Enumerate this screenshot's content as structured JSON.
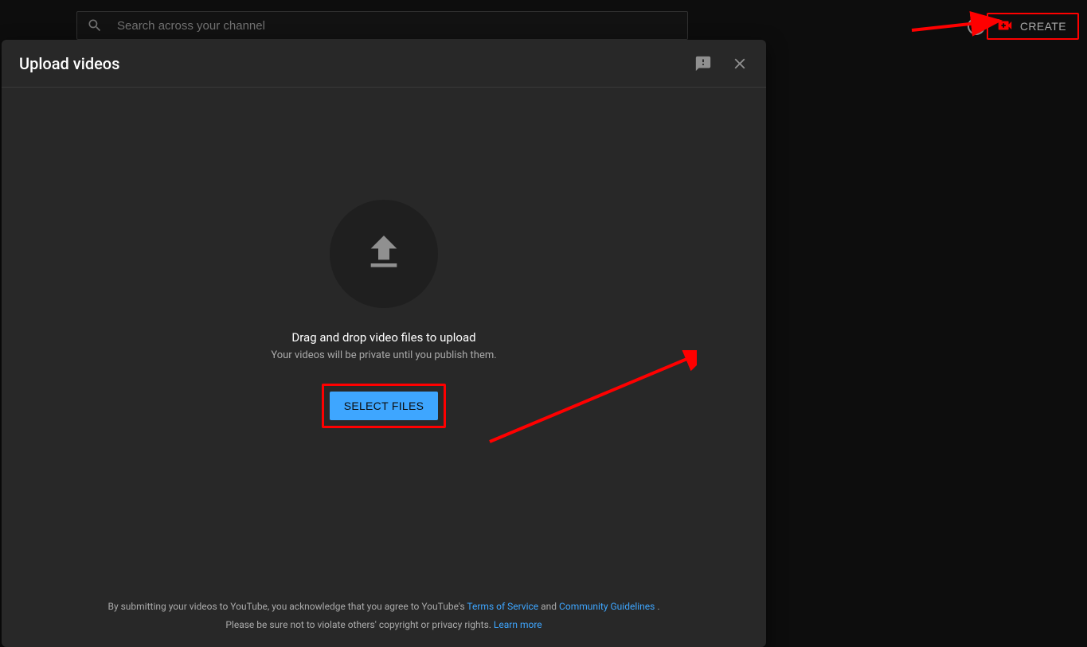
{
  "topbar": {
    "search_placeholder": "Search across your channel",
    "create_label": "CREATE"
  },
  "modal": {
    "title": "Upload videos",
    "drag_title": "Drag and drop video files to upload",
    "drag_sub": "Your videos will be private until you publish them.",
    "select_button": "SELECT FILES",
    "footer_prefix": "By submitting your videos to YouTube, you acknowledge that you agree to YouTube's ",
    "tos": "Terms of Service",
    "and": " and ",
    "community": "Community Guidelines",
    "period": ".",
    "footer_line2_prefix": "Please be sure not to violate others' copyright or privacy rights. ",
    "learn_more": "Learn more"
  },
  "icons": {
    "search": "search-icon",
    "help": "help-icon",
    "create": "create-video-icon",
    "feedback": "feedback-icon",
    "close": "close-icon",
    "upload": "upload-arrow-icon"
  }
}
